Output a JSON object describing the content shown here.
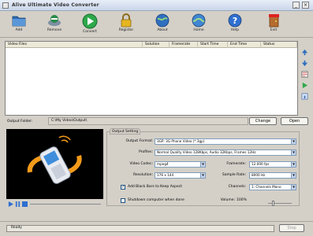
{
  "window": {
    "title": "Alive Ultimate Video Converter",
    "minimize": "_",
    "close": "×"
  },
  "toolbar": {
    "items": [
      {
        "label": "Add",
        "icon": "add-folder-icon"
      },
      {
        "label": "Remove",
        "icon": "remove-icon"
      },
      {
        "label": "Convert",
        "icon": "convert-play-icon"
      },
      {
        "label": "Register",
        "icon": "padlock-icon"
      },
      {
        "label": "About",
        "icon": "globe-about-icon"
      },
      {
        "label": "Home",
        "icon": "globe-home-icon"
      },
      {
        "label": "Help",
        "icon": "help-icon"
      },
      {
        "label": "Exit",
        "icon": "exit-door-icon"
      }
    ]
  },
  "file_list": {
    "columns": [
      "Video Files",
      "Solution",
      "Framerate",
      "Start Time",
      "End Time",
      "Status"
    ]
  },
  "output": {
    "label": "Output Folder:",
    "path": "C:\\My Video\\Output\\",
    "change_label": "Change",
    "open_label": "Open"
  },
  "settings": {
    "tab_label": "Output Setting",
    "output_format_label": "Output Format:",
    "output_format_value": "3GP: 3G Phone Video (*.3gp)",
    "profile_label": "Profiles:",
    "profile_value": "Normal Quality Video 128Kbps, Audio 32Kbps, Frames 12Hz",
    "video_codec_label": "Video Codec:",
    "video_codec_value": "mpeg4",
    "framerate_label": "Framerate:",
    "framerate_value": "12.000 fps",
    "resolution_label": "Resolution:",
    "resolution_value": "176 x 144",
    "sample_rate_label": "Sample Rate:",
    "sample_rate_value": "8000 Hz",
    "aspect_checked": true,
    "aspect_label": "Add Black Bars to Keep Aspect",
    "channels_label": "Channels:",
    "channels_value": "1: Channels Mono",
    "shutdown_checked": false,
    "shutdown_label": "Shutdown computer when done",
    "volume_label": "Volume:",
    "volume_value": "100%",
    "volume_level": 0.2
  },
  "player": {
    "controls": [
      "play-icon",
      "pause-icon",
      "stop-icon"
    ]
  },
  "status": {
    "text": "Ready",
    "stop_label": "Stop",
    "progress": 0
  }
}
